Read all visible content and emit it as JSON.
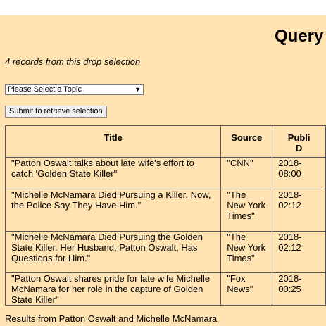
{
  "header": {
    "title": "Query"
  },
  "summary": {
    "count_text": "4 records from this drop selection"
  },
  "form": {
    "topic_select_value": "Please Select a Topic",
    "submit_label": "Submit to retrieve selection"
  },
  "table": {
    "headers": [
      "Title",
      "Source",
      "Publi",
      "D"
    ],
    "rows": [
      {
        "title": "\"Patton Oswalt talks about late wife's effort to catch 'Golden State Killer'\"",
        "source": "\"CNN\"",
        "date": "2018-",
        "time": "08:00"
      },
      {
        "title": "\"Michelle McNamara Died Pursuing a Killer. Now, the Police Say They Have Him.\"",
        "source": "\"The New York Times\"",
        "date": "2018-",
        "time": "02:12"
      },
      {
        "title": "\"Michelle McNamara Died Pursuing the Golden State Killer. Her Husband, Patton Oswalt, Has Questions for Him.\"",
        "source": "\"The New York Times\"",
        "date": "2018-",
        "time": "02:12"
      },
      {
        "title": "\"Patton Oswalt shares pride for late wife Michelle McNamara for her role in the capture of Golden State Killer\"",
        "source": "\"Fox News\"",
        "date": "2018-",
        "time": "00:25"
      }
    ]
  },
  "footer": {
    "text": "Results from Patton Oswalt and Michelle McNamara"
  },
  "colors": {
    "background": "#ffe3b3",
    "border": "#555555"
  }
}
